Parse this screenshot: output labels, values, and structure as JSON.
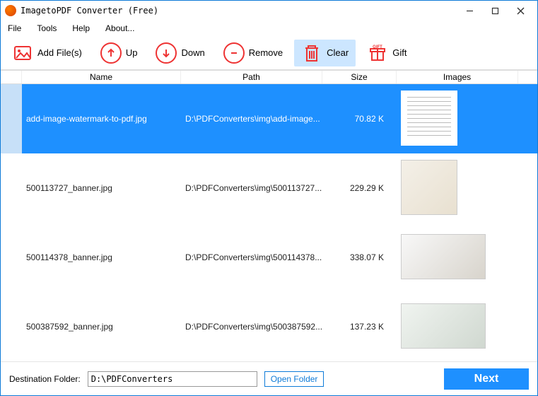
{
  "window": {
    "title": "ImagetoPDF Converter (Free)"
  },
  "menu": {
    "file": "File",
    "tools": "Tools",
    "help": "Help",
    "about": "About..."
  },
  "toolbar": {
    "add": "Add File(s)",
    "up": "Up",
    "down": "Down",
    "remove": "Remove",
    "clear": "Clear",
    "gift": "Gift"
  },
  "columns": {
    "name": "Name",
    "path": "Path",
    "size": "Size",
    "images": "Images"
  },
  "rows": [
    {
      "name": "add-image-watermark-to-pdf.jpg",
      "path": "D:\\PDFConverters\\img\\add-image...",
      "size": "70.82 K",
      "selected": true,
      "thumb": "doc"
    },
    {
      "name": "500113727_banner.jpg",
      "path": "D:\\PDFConverters\\img\\500113727...",
      "size": "229.29 K",
      "selected": false,
      "thumb": "photo1"
    },
    {
      "name": "500114378_banner.jpg",
      "path": "D:\\PDFConverters\\img\\500114378...",
      "size": "338.07 K",
      "selected": false,
      "thumb": "photo2"
    },
    {
      "name": "500387592_banner.jpg",
      "path": "D:\\PDFConverters\\img\\500387592...",
      "size": "137.23 K",
      "selected": false,
      "thumb": "photo3"
    }
  ],
  "bottom": {
    "dest_label": "Destination Folder:",
    "dest_value": "D:\\PDFConverters",
    "open_folder": "Open Folder",
    "next": "Next"
  }
}
